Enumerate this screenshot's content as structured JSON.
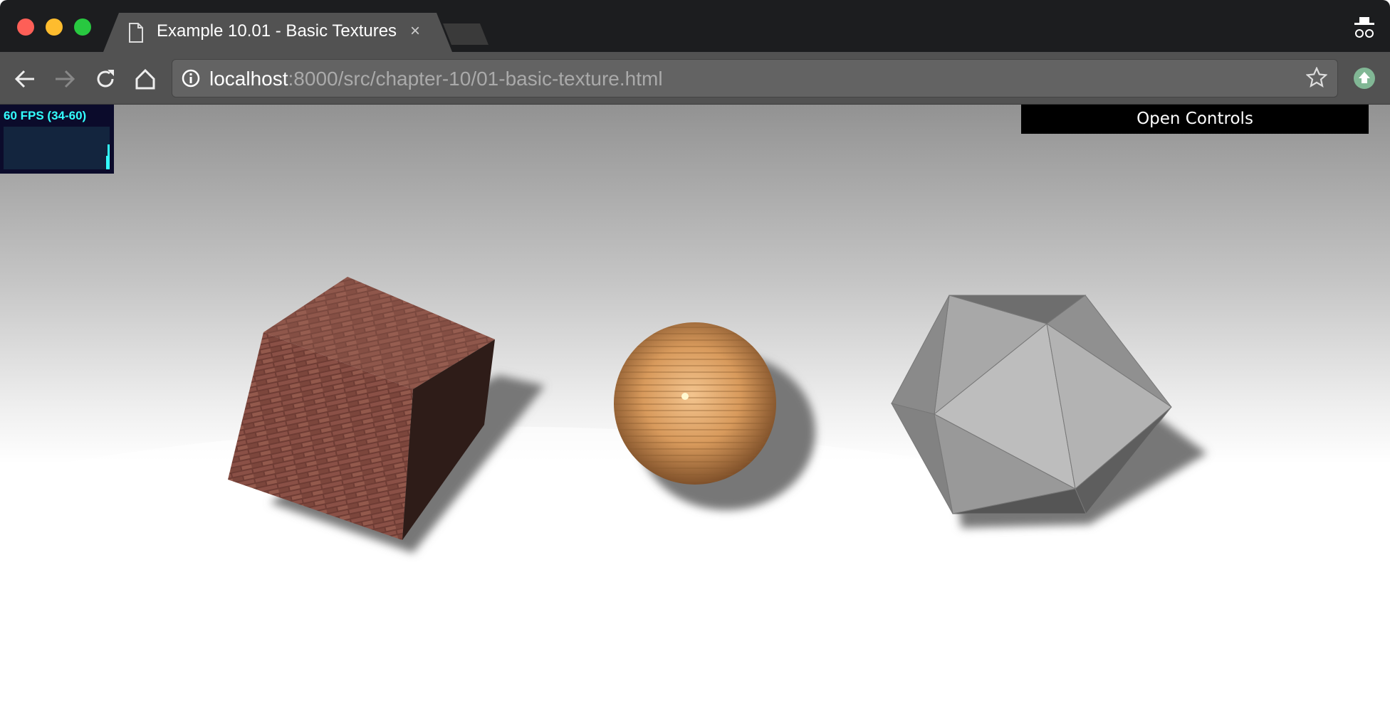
{
  "browser": {
    "tab_title": "Example 10.01 - Basic Textures",
    "tab_close": "×",
    "url_host": "localhost",
    "url_path": ":8000/src/chapter-10/01-basic-texture.html",
    "icons": [
      "back-icon",
      "forward-icon",
      "reload-icon",
      "home-icon",
      "info-icon",
      "star-icon",
      "update-icon",
      "incognito-icon",
      "page-icon"
    ]
  },
  "stats": {
    "fps_label": "60 FPS (34-60)",
    "fps_color": "#33ffff"
  },
  "gui": {
    "open_controls": "Open Controls"
  }
}
